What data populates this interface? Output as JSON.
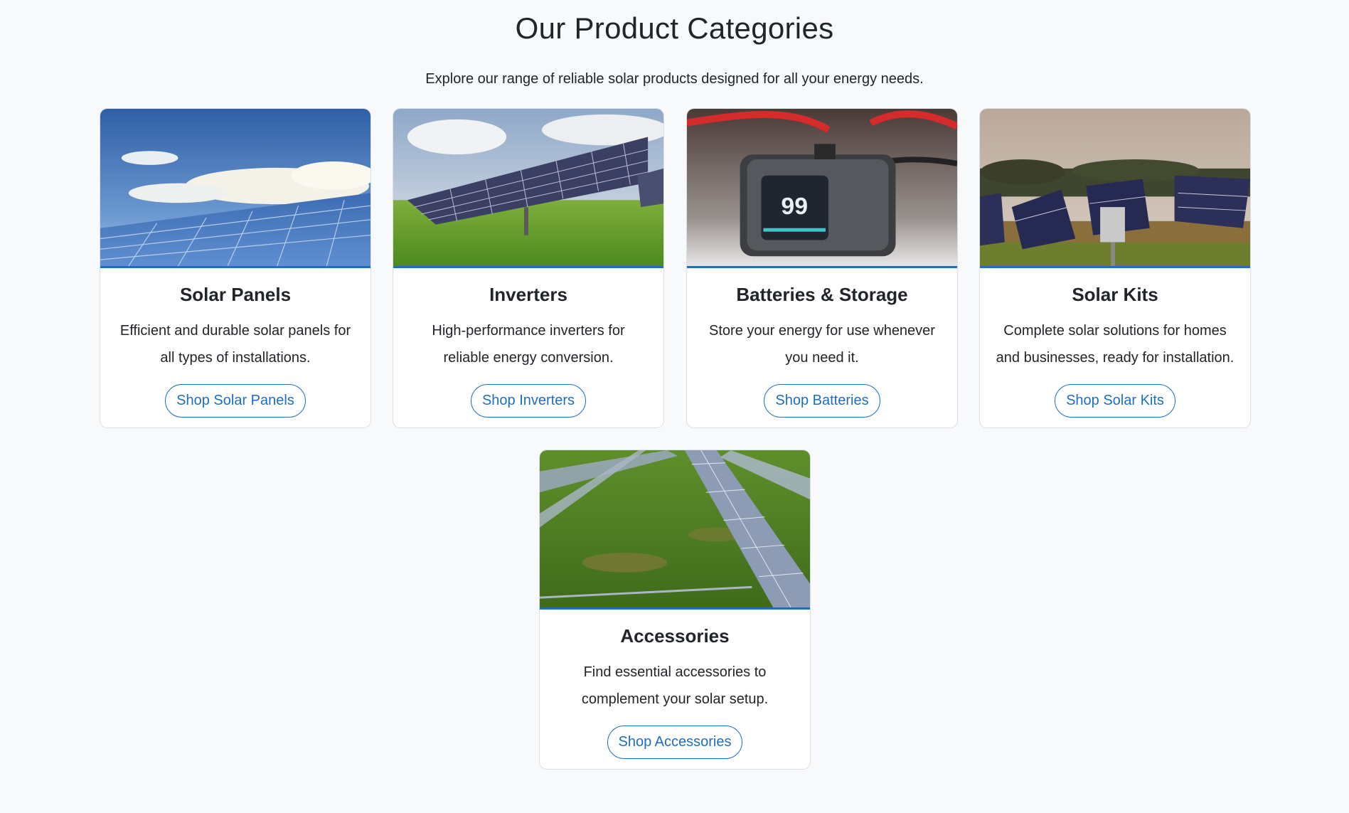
{
  "section": {
    "title": "Our Product Categories",
    "subtitle": "Explore our range of reliable solar products designed for all your energy needs."
  },
  "colors": {
    "accent": "#1b6ec2",
    "background": "#f8f9fa",
    "card_border": "#dcdfe3"
  },
  "cards": [
    {
      "title": "Solar Panels",
      "description": "Efficient and durable solar panels for all types of installations.",
      "button_label": "Shop Solar Panels",
      "image": "solar-panels-sky-photo"
    },
    {
      "title": "Inverters",
      "description": "High-performance inverters for reliable energy conversion.",
      "button_label": "Shop Inverters",
      "image": "solar-array-field-photo"
    },
    {
      "title": "Batteries & Storage",
      "description": "Store your energy for use whenever you need it.",
      "button_label": "Shop Batteries",
      "image": "battery-device-photo",
      "image_text": "99"
    },
    {
      "title": "Solar Kits",
      "description": "Complete solar solutions for homes and businesses, ready for installation.",
      "button_label": "Shop Solar Kits",
      "image": "solar-kit-field-photo"
    },
    {
      "title": "Accessories",
      "description": "Find essential accessories to complement your solar setup.",
      "button_label": "Shop Accessories",
      "image": "solar-rows-grass-photo"
    }
  ]
}
